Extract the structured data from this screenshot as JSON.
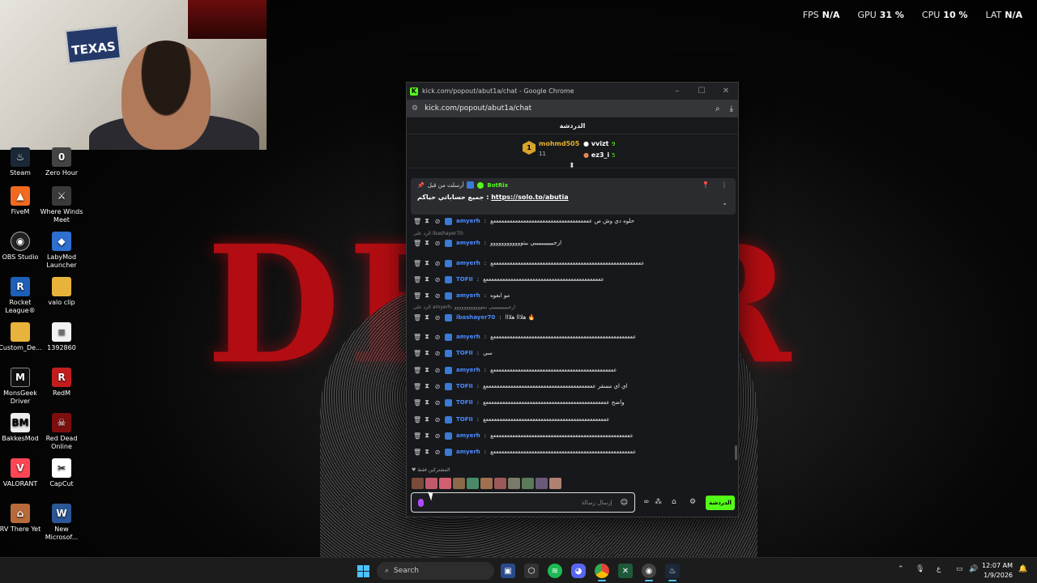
{
  "perf": [
    {
      "label": "FPS",
      "value": "N/A"
    },
    {
      "label": "GPU",
      "value": "31 %"
    },
    {
      "label": "CPU",
      "value": "10 %"
    },
    {
      "label": "LAT",
      "value": "N/A"
    }
  ],
  "wallpaper": {
    "title": "DEV    R"
  },
  "webcam": {
    "poster_text": "TEXAS"
  },
  "desktop_icons": [
    {
      "label": "Steam",
      "icon": "steam-icon"
    },
    {
      "label": "Zero Hour",
      "icon": "zero-hour-icon"
    },
    {
      "label": "FiveM",
      "icon": "fivem-icon"
    },
    {
      "label": "Where Winds Meet",
      "icon": "where-winds-meet-icon"
    },
    {
      "label": "OBS Studio",
      "icon": "obs-icon"
    },
    {
      "label": "LabyMod Launcher",
      "icon": "labymod-icon"
    },
    {
      "label": "Rocket League®",
      "icon": "rocket-league-icon"
    },
    {
      "label": "valo clip",
      "icon": "folder-icon"
    },
    {
      "label": "Custom_De...",
      "icon": "folder-icon"
    },
    {
      "label": "1392860",
      "icon": "file-icon"
    },
    {
      "label": "MonsGeek Driver",
      "icon": "monsgeek-icon"
    },
    {
      "label": "RedM",
      "icon": "redm-icon"
    },
    {
      "label": "BakkesMod",
      "icon": "bakkesmod-icon"
    },
    {
      "label": "Red Dead Online",
      "icon": "red-dead-icon"
    },
    {
      "label": "VALORANT",
      "icon": "valorant-icon"
    },
    {
      "label": "CapCut",
      "icon": "capcut-icon"
    },
    {
      "label": "RV There Yet",
      "icon": "rv-icon"
    },
    {
      "label": "New Microsof...",
      "icon": "word-icon"
    }
  ],
  "browser": {
    "title": "kick.com/popout/abut1a/chat - Google Chrome",
    "url": "kick.com/popout/abut1a/chat"
  },
  "chat": {
    "header": "الدردشة",
    "gifters": [
      {
        "rank": "1",
        "name": "mohmd505",
        "count": "11"
      },
      {
        "name": "vvizt",
        "count": "9"
      },
      {
        "name": "ez3_i",
        "count": "5"
      }
    ],
    "pinned": {
      "pinned_by": "أرسلت من قبل",
      "bot": "BotRix",
      "text": "جميع حساباتي حياكم",
      "link": "https://solo.to/abutia"
    },
    "messages": [
      {
        "user": "amyerh",
        "text": "حلوه دي وش ص ععععععععععععععععععععععععععععععععععععع"
      },
      {
        "reply": "الرد على ibashayer70:"
      },
      {
        "user": "amyerh",
        "text": "ارجيييييييييييي بيتوووووووووووو"
      },
      {
        "user": "amyerh",
        "text": "عععععععععععععععععععععععععععععععععععععععععععععععععععععععع"
      },
      {
        "user": "TOFII",
        "text": "عععععععععععععععععععععععععععععععععععععععععععع"
      },
      {
        "user": "amyerh",
        "text": "مو ابغوه"
      },
      {
        "reply": "الرد على amyerh: ارجيييييييييييي بيتوووووووووووو"
      },
      {
        "user": "ibashayer70",
        "text": "هلااا هلااا 🔥"
      },
      {
        "user": "amyerh",
        "text": "ععععععععععععععععععععععععععععععععععععععععععععععععععععع"
      },
      {
        "user": "TOFII",
        "text": "سي"
      },
      {
        "user": "amyerh",
        "text": "عععععععععععععععععععععععععععععععععععععععععععععع"
      },
      {
        "user": "TOFII",
        "text": "اي اي مسقر ععععععععععععععععععععععععععععععععععععععععع"
      },
      {
        "user": "TOFII",
        "text": "واضح عععععععععععععععععععععععععععععععععععععععععععععع"
      },
      {
        "user": "TOFII",
        "text": "عععععععععععععععععععععععععععععععععععععععععععععع"
      },
      {
        "user": "amyerh",
        "text": "عععععععععععععععععععععععععععععععععععععععععععععععععععع"
      },
      {
        "user": "amyerh",
        "text": "ععععععععععععععععععععععععععععععععععععععععععععععععععععع"
      }
    ],
    "subs_label": "المشتركين فقط",
    "composer_placeholder": "إرسال رسالة",
    "send_label": "الدردشة"
  },
  "taskbar": {
    "search_label": "Search",
    "time": "12:07 AM",
    "date": "1/9/2026",
    "lang": "ع"
  },
  "colors": {
    "kick_green": "#53fc18",
    "user_blue": "#4a8bff"
  }
}
